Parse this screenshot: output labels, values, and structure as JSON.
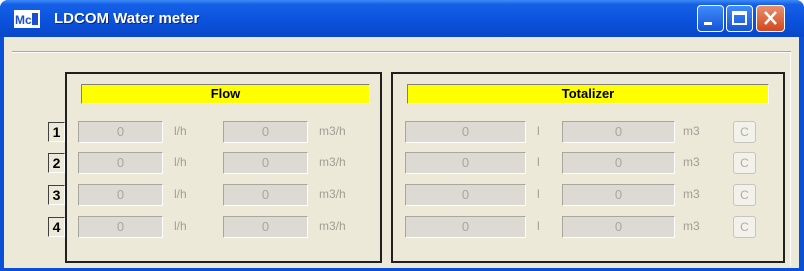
{
  "window": {
    "title": "LDCOM  Water meter",
    "app_icon": "ldcom-app-icon"
  },
  "title_buttons": {
    "minimize_icon": "minimize-icon",
    "maximize_icon": "maximize-icon",
    "close_icon": "close-icon"
  },
  "flow": {
    "header": "Flow",
    "unit_left": "l/h",
    "unit_right": "m3/h"
  },
  "totalizer": {
    "header": "Totalizer",
    "unit_left": "l",
    "unit_right": "m3",
    "clear_label": "C"
  },
  "rows": [
    {
      "label": "1",
      "flow_lh": "0",
      "flow_m3h": "0",
      "tot_l": "0",
      "tot_m3": "0"
    },
    {
      "label": "2",
      "flow_lh": "0",
      "flow_m3h": "0",
      "tot_l": "0",
      "tot_m3": "0"
    },
    {
      "label": "3",
      "flow_lh": "0",
      "flow_m3h": "0",
      "tot_l": "0",
      "tot_m3": "0"
    },
    {
      "label": "4",
      "flow_lh": "0",
      "flow_m3h": "0",
      "tot_l": "0",
      "tot_m3": "0"
    }
  ]
}
